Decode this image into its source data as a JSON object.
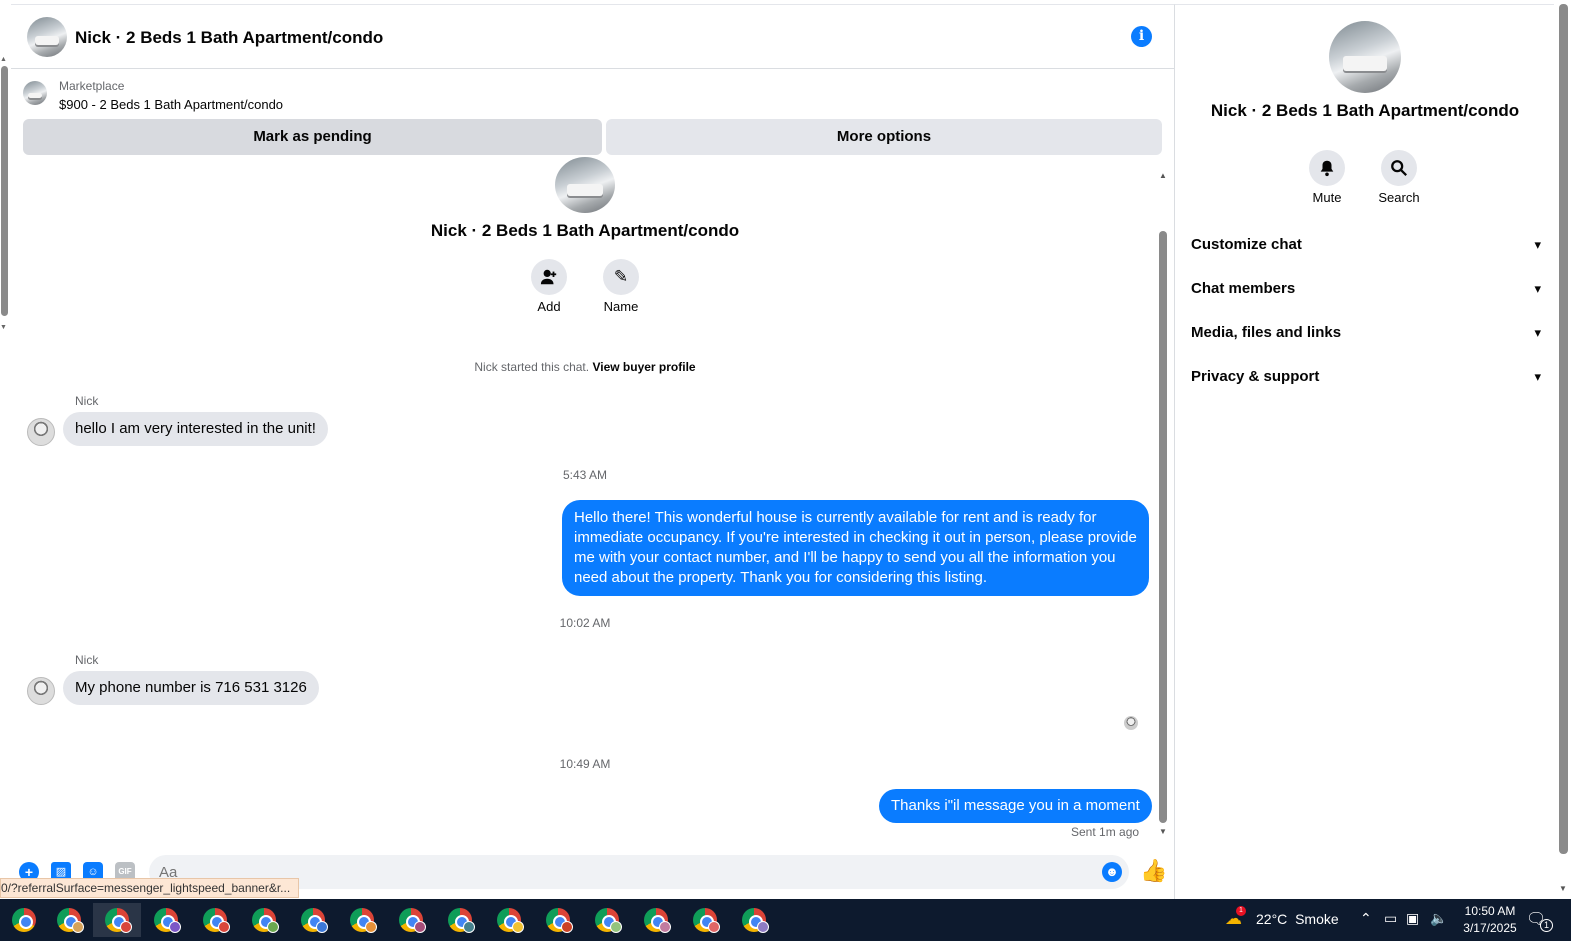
{
  "header": {
    "title": "Nick · 2 Beds 1 Bath Apartment/condo"
  },
  "listing": {
    "source": "Marketplace",
    "title": "$900 - 2 Beds 1 Bath Apartment/condo",
    "pending_label": "Mark as pending",
    "more_label": "More options"
  },
  "intro": {
    "title": "Nick · 2 Beds 1 Bath Apartment/condo",
    "add_label": "Add",
    "name_label": "Name",
    "started_text": "Nick started this chat.",
    "buyer_profile_link": "View buyer profile"
  },
  "messages": [
    {
      "sender": "Nick",
      "text": "hello I am very interested in the unit!"
    },
    {
      "timestamp": "5:43 AM"
    },
    {
      "text": "Hello there! This wonderful house is currently available for rent and is ready for immediate occupancy. If you're interested in checking it out in person, please provide me with your contact number, and I'll be happy to send you all the information you need about the property. Thank you for considering this listing."
    },
    {
      "timestamp": "10:02 AM"
    },
    {
      "sender": "Nick",
      "text": "My phone number is 716 531 3126"
    },
    {
      "timestamp": "10:49 AM"
    },
    {
      "text": "Thanks i\"il message you in a moment",
      "status": "Sent 1m ago"
    }
  ],
  "composer": {
    "placeholder": "Aa",
    "gif_label": "GIF"
  },
  "status_url": "0/?referralSurface=messenger_lightspeed_banner&r...",
  "sidebar": {
    "title": "Nick · 2 Beds 1 Bath Apartment/condo",
    "mute_label": "Mute",
    "search_label": "Search",
    "sections": [
      "Customize chat",
      "Chat members",
      "Media, files and links",
      "Privacy & support"
    ]
  },
  "taskbar": {
    "weather_temp": "22°C",
    "weather_desc": "Smoke",
    "weather_badge": "1",
    "time": "10:50 AM",
    "date": "3/17/2025",
    "notification_count": "1"
  },
  "colors": {
    "accent": "#0a7cff",
    "bubble_in": "#e4e6eb",
    "taskbar": "#0d1a2e"
  }
}
